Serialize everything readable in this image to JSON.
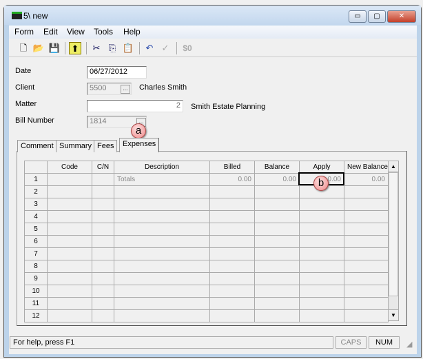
{
  "window": {
    "title": "5\\ new",
    "minimize": "▭",
    "maximize": "▢",
    "close": "✕"
  },
  "menu": [
    "Form",
    "Edit",
    "View",
    "Tools",
    "Help"
  ],
  "toolbar": {
    "new": "🗋",
    "open": "📂",
    "save": "💾",
    "up": "⬆",
    "cut": "✂",
    "copy": "⎘",
    "paste": "📋",
    "undo": "↶",
    "spell": "✓",
    "dollar": "$0"
  },
  "form": {
    "date_label": "Date",
    "date_value": "06/27/2012",
    "client_label": "Client",
    "client_value": "5500",
    "client_name": "Charles Smith",
    "matter_label": "Matter",
    "matter_value": "2",
    "matter_name": "Smith Estate Planning",
    "bill_label": "Bill Number",
    "bill_value": "1814",
    "ellipsis": "..."
  },
  "tabs": [
    "Comment",
    "Summary",
    "Fees",
    "Expenses"
  ],
  "grid": {
    "headers": [
      "",
      "Code",
      "C/N",
      "Description",
      "Billed",
      "Balance",
      "Apply",
      "New Balance"
    ],
    "rows": [
      {
        "num": "1",
        "desc": "Totals",
        "billed": "0.00",
        "balance": "0.00",
        "apply": "0.00",
        "new_balance": "0.00"
      },
      {
        "num": "2"
      },
      {
        "num": "3"
      },
      {
        "num": "4"
      },
      {
        "num": "5"
      },
      {
        "num": "6"
      },
      {
        "num": "7"
      },
      {
        "num": "8"
      },
      {
        "num": "9"
      },
      {
        "num": "10"
      },
      {
        "num": "11"
      },
      {
        "num": "12"
      }
    ]
  },
  "callouts": {
    "a": "a",
    "b": "b"
  },
  "status": {
    "help": "For help, press F1",
    "caps": "CAPS",
    "num": "NUM"
  }
}
